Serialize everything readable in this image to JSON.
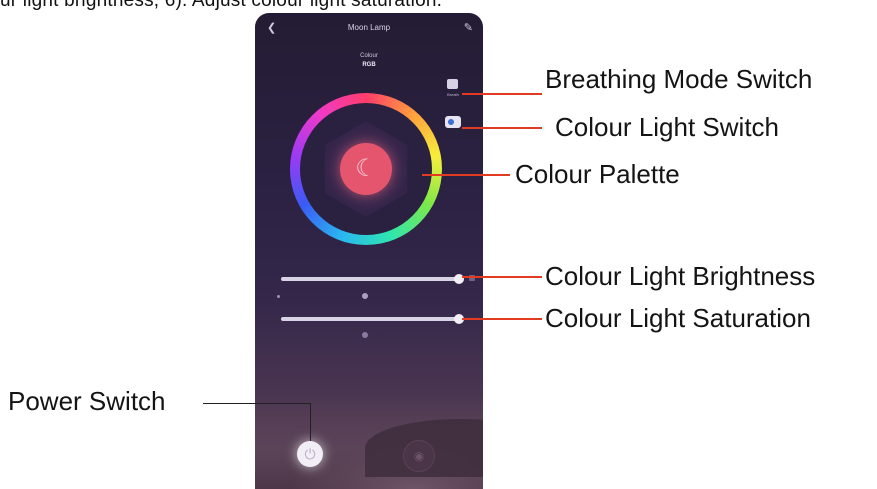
{
  "caption": {
    "text": "ur light brightness, 6). Adjust colour light saturation."
  },
  "app": {
    "title": "Moon Lamp",
    "status_label": "Colour",
    "status_value": "RGB",
    "breathing_caption": "Breath"
  },
  "callouts": {
    "breathing": "Breathing Mode Switch",
    "colour_light": "Colour Light Switch",
    "palette": "Colour Palette",
    "brightness": "Colour Light Brightness",
    "saturation": "Colour Light Saturation",
    "power": "Power Switch"
  },
  "icons": {
    "back": "back-icon",
    "edit": "edit-icon",
    "moon": "moon-icon",
    "power": "power-icon",
    "mode": "mode-icon"
  },
  "sliders": {
    "brightness_level": 0.95,
    "saturation_level": 0.95
  },
  "colors": {
    "callout_line": "#e23b22",
    "center_button": "#e5556e",
    "phone_background": "#2b2142"
  }
}
